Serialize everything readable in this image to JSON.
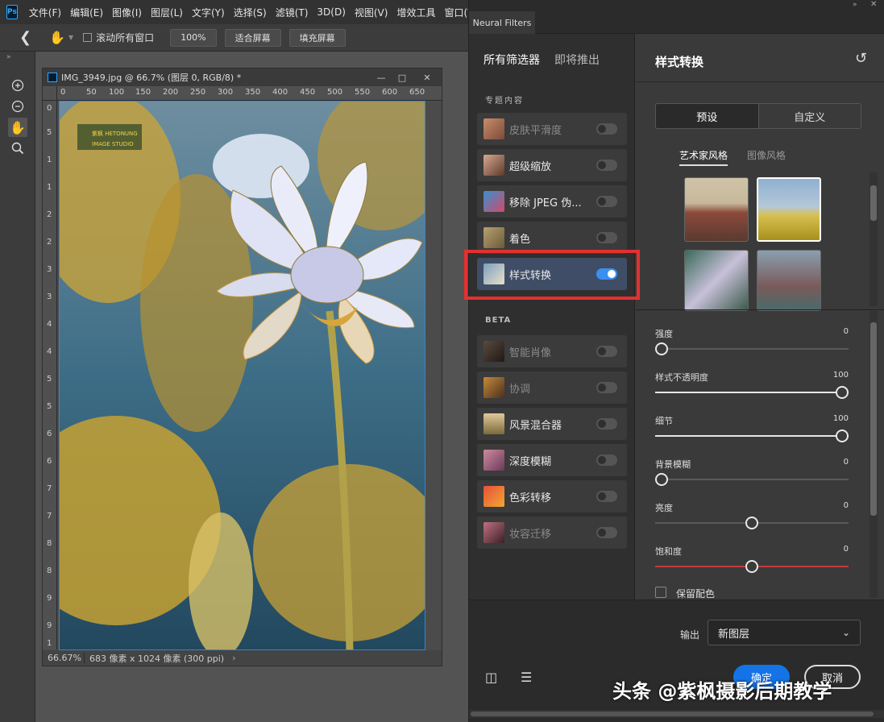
{
  "app": {
    "logo": "Ps"
  },
  "menu": [
    "文件(F)",
    "编辑(E)",
    "图像(I)",
    "图层(L)",
    "文字(Y)",
    "选择(S)",
    "滤镜(T)",
    "3D(D)",
    "视图(V)",
    "增效工具",
    "窗口(W)"
  ],
  "options": {
    "scroll_all_label": "滚动所有窗口",
    "zoom": "100%",
    "fit_screen": "适合屏幕",
    "fill_screen": "填充屏幕"
  },
  "document": {
    "title": "IMG_3949.jpg @ 66.7% (图层 0, RGB/8) *",
    "ruler_top": [
      "0",
      "50",
      "100",
      "150",
      "200",
      "250",
      "300",
      "350",
      "400",
      "450",
      "500",
      "550",
      "600",
      "650"
    ],
    "ruler_left": [
      "0",
      "5",
      "1",
      "1",
      "2",
      "2",
      "3",
      "3",
      "4",
      "4",
      "5",
      "5",
      "6",
      "6",
      "7",
      "7",
      "8",
      "8",
      "9",
      "9",
      "1"
    ],
    "zoom_status": "66.67%",
    "size_status": "683 像素 x 1024 像素 (300 ppi)",
    "logo_text_line1": "紫枫 HETONUNG",
    "logo_text_line2": "IMAGE STUDIO"
  },
  "panel": {
    "title": "Neural Filters",
    "tab_all": "所有筛选器",
    "tab_coming": "即将推出",
    "section_featured": "专题内容",
    "section_beta": "BETA",
    "featured_filters": [
      {
        "label": "皮肤平滑度",
        "enabled": false,
        "on": false
      },
      {
        "label": "超级缩放",
        "enabled": true,
        "on": false
      },
      {
        "label": "移除 JPEG 伪...",
        "enabled": true,
        "on": false
      },
      {
        "label": "着色",
        "enabled": true,
        "on": false
      },
      {
        "label": "样式转换",
        "enabled": true,
        "on": true
      }
    ],
    "beta_filters": [
      {
        "label": "智能肖像",
        "enabled": false,
        "on": false
      },
      {
        "label": "协调",
        "enabled": false,
        "on": false
      },
      {
        "label": "风景混合器",
        "enabled": true,
        "on": false
      },
      {
        "label": "深度模糊",
        "enabled": true,
        "on": false
      },
      {
        "label": "色彩转移",
        "enabled": true,
        "on": false
      },
      {
        "label": "妆容迁移",
        "enabled": false,
        "on": false
      }
    ],
    "detail_title": "样式转换",
    "seg_preset": "预设",
    "seg_custom": "自定义",
    "subtab_artist": "艺术家风格",
    "subtab_image": "图像风格",
    "sliders": [
      {
        "label": "强度",
        "value": "0",
        "pos": 0.0,
        "color": "#5a5a5a"
      },
      {
        "label": "样式不透明度",
        "value": "100",
        "pos": 1.0,
        "color": "#e6e6e6"
      },
      {
        "label": "细节",
        "value": "100",
        "pos": 1.0,
        "color": "#e6e6e6"
      },
      {
        "label": "背景模糊",
        "value": "0",
        "pos": 0.0,
        "color": "#5a5a5a"
      },
      {
        "label": "亮度",
        "value": "0",
        "pos": 0.5,
        "color": "#5a5a5a"
      },
      {
        "label": "饱和度",
        "value": "0",
        "pos": 0.5,
        "color": "#c23b3b"
      }
    ],
    "preserve_color": "保留配色",
    "output_label": "输出",
    "output_value": "新图层",
    "ok_label": "确定",
    "cancel_label": "取消"
  },
  "watermark": "头条 @紫枫摄影后期教学",
  "colors": {
    "accent": "#3b8ff0",
    "highlight_box": "#e53030",
    "ok_button": "#1473e6"
  }
}
